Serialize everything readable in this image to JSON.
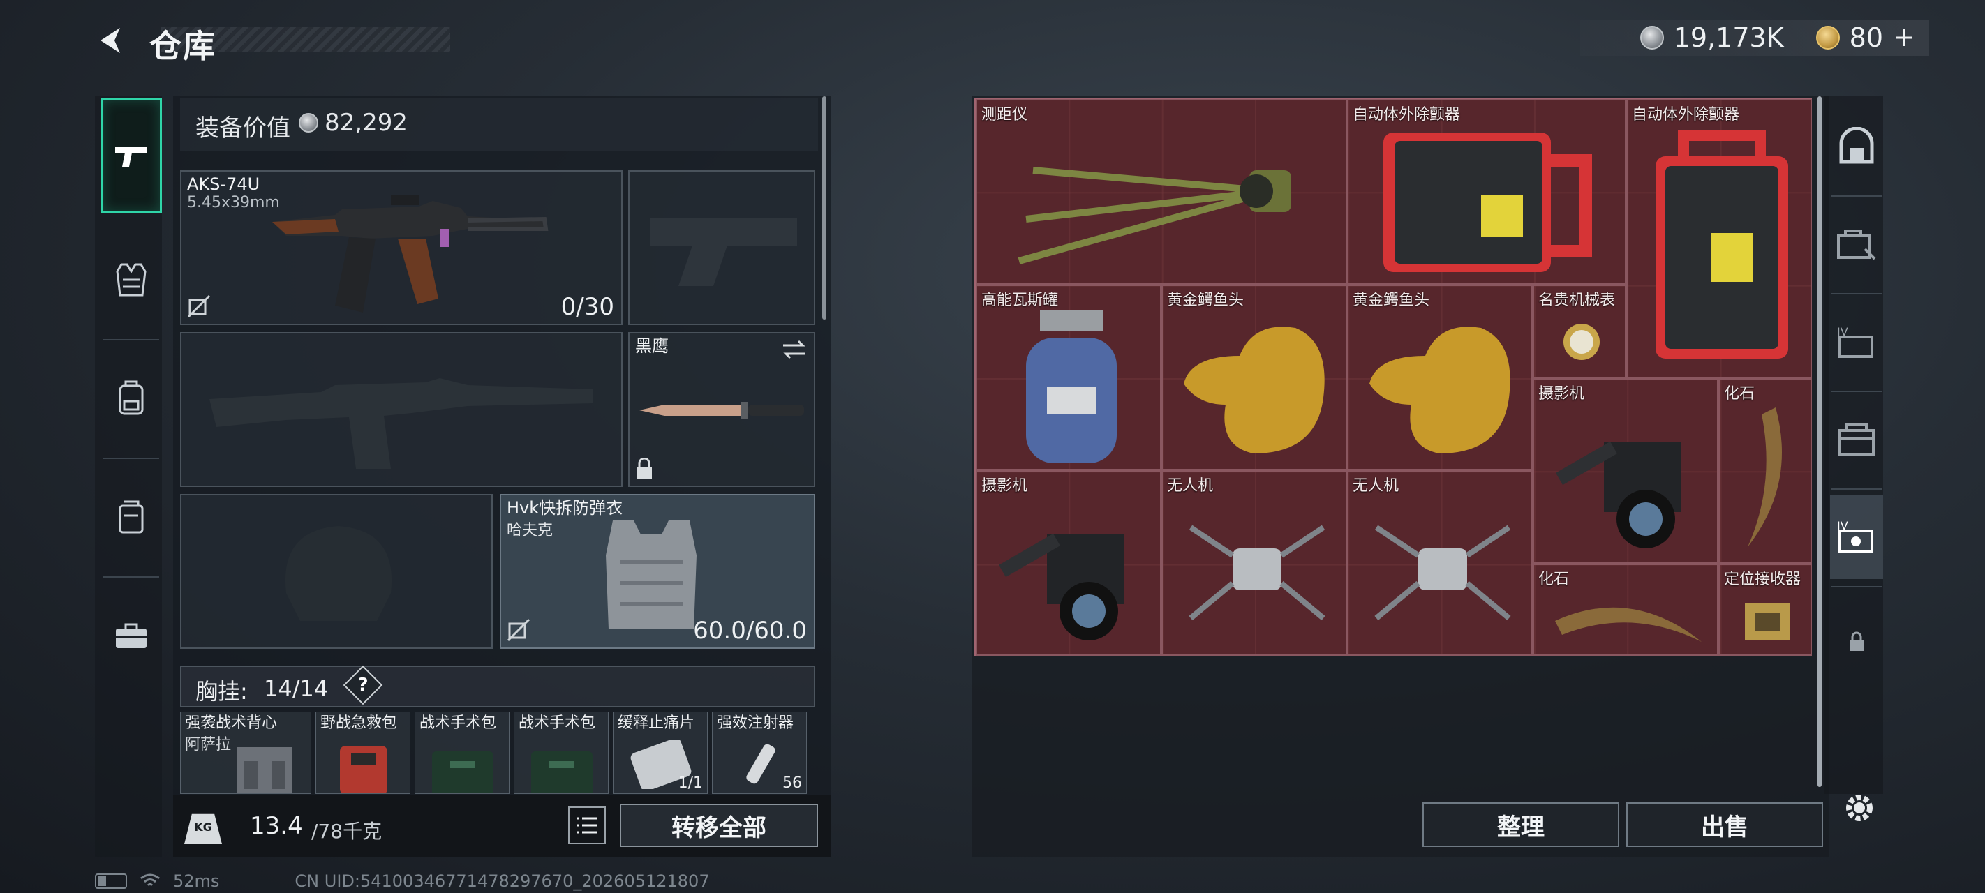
{
  "header": {
    "title": "仓库",
    "currency_silver": "19,173K",
    "currency_gold": "80"
  },
  "nav": {
    "items": [
      "weapons-icon",
      "armor-icon",
      "backpack-icon",
      "pouch-icon",
      "toolbox-icon"
    ]
  },
  "equipment": {
    "value_label": "装备价值",
    "value": "82,292",
    "primary_weapon": {
      "name": "AKS-74U",
      "ammo_type": "5.45x39mm",
      "ammo": "0/30"
    },
    "melee": {
      "name": "黑鹰"
    },
    "armor": {
      "name": "Hvk快拆防弹衣",
      "sub": "哈夫克",
      "durability": "60.0/60.0"
    },
    "chest_label": "胸挂:",
    "chest_value": "14/14",
    "chest_help": "?",
    "chest_items": [
      {
        "label": "强袭战术背心",
        "sub": "阿萨拉"
      },
      {
        "label": "野战急救包",
        "sub": ""
      },
      {
        "label": "战术手术包",
        "sub": ""
      },
      {
        "label": "战术手术包",
        "sub": ""
      },
      {
        "label": "缓释止痛片",
        "sub": "1/1"
      },
      {
        "label": "强效注射器",
        "sub": "56"
      }
    ]
  },
  "footer": {
    "kg": "KG",
    "weight": "13.4",
    "weight_max": "/78千克",
    "transfer_all": "转移全部"
  },
  "storage": {
    "items": [
      {
        "label": "测距仪"
      },
      {
        "label": "自动体外除颤器"
      },
      {
        "label": "自动体外除颤器"
      },
      {
        "label": "高能瓦斯罐"
      },
      {
        "label": "黄金鳄鱼头"
      },
      {
        "label": "黄金鳄鱼头"
      },
      {
        "label": "名贵机械表"
      },
      {
        "label": "摄影机"
      },
      {
        "label": "化石"
      },
      {
        "label": "摄影机"
      },
      {
        "label": "无人机"
      },
      {
        "label": "无人机"
      },
      {
        "label": "化石"
      },
      {
        "label": "定位接收器"
      }
    ],
    "sort_label": "整理",
    "sell_label": "出售"
  },
  "status": {
    "ping": "52ms",
    "uid": "CN UID:541003467714782976​70_202605121807"
  },
  "colors": {
    "accent": "#2fd5a8",
    "grid_bg": "#4a2328"
  }
}
